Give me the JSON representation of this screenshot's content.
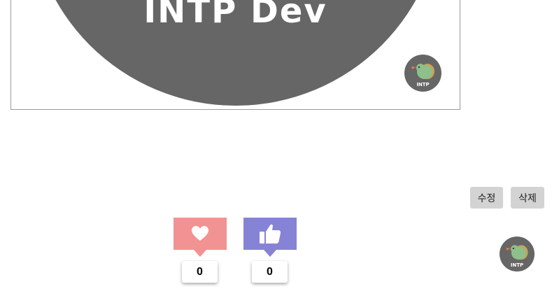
{
  "banner": {
    "title": "INTP Dev",
    "logo_text": "INTP"
  },
  "actions": {
    "edit_label": "수정",
    "delete_label": "삭제"
  },
  "reactions": {
    "heart_count": "0",
    "like_count": "0"
  },
  "footer_logo_text": "INTP",
  "colors": {
    "banner_bg": "#666666",
    "heart": "#f29393",
    "thumb": "#8683d6",
    "button_bg": "#d3d3d3"
  },
  "icons": [
    "heart-icon",
    "thumbs-up-icon",
    "dinosaur-logo-icon"
  ]
}
